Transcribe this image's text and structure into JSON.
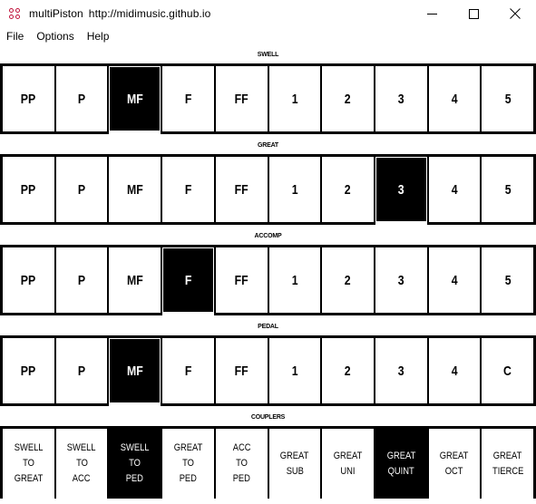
{
  "window": {
    "app_name": "multiPiston",
    "url": "http://midimusic.github.io"
  },
  "menu": [
    "File",
    "Options",
    "Help"
  ],
  "divisions": [
    {
      "label": "SWELL",
      "pistons": [
        "PP",
        "P",
        "MF",
        "F",
        "FF",
        "1",
        "2",
        "3",
        "4",
        "5"
      ],
      "active": "MF"
    },
    {
      "label": "GREAT",
      "pistons": [
        "PP",
        "P",
        "MF",
        "F",
        "FF",
        "1",
        "2",
        "3",
        "4",
        "5"
      ],
      "active": "3"
    },
    {
      "label": "ACCOMP",
      "pistons": [
        "PP",
        "P",
        "MF",
        "F",
        "FF",
        "1",
        "2",
        "3",
        "4",
        "5"
      ],
      "active": "F"
    },
    {
      "label": "PEDAL",
      "pistons": [
        "PP",
        "P",
        "MF",
        "F",
        "FF",
        "1",
        "2",
        "3",
        "4",
        "C"
      ],
      "active": "MF"
    }
  ],
  "couplers": {
    "label": "COUPLERS",
    "items": [
      {
        "lines": [
          "SWELL",
          "TO",
          "GREAT"
        ],
        "active": false
      },
      {
        "lines": [
          "SWELL",
          "TO",
          "ACC"
        ],
        "active": false
      },
      {
        "lines": [
          "SWELL",
          "TO",
          "PED"
        ],
        "active": true
      },
      {
        "lines": [
          "GREAT",
          "TO",
          "PED"
        ],
        "active": false
      },
      {
        "lines": [
          "ACC",
          "TO",
          "PED"
        ],
        "active": false
      },
      {
        "lines": [
          "GREAT",
          "SUB"
        ],
        "active": false
      },
      {
        "lines": [
          "GREAT",
          "UNI"
        ],
        "active": false
      },
      {
        "lines": [
          "GREAT",
          "QUINT"
        ],
        "active": true
      },
      {
        "lines": [
          "GREAT",
          "OCT"
        ],
        "active": false
      },
      {
        "lines": [
          "GREAT",
          "TIERCE"
        ],
        "active": false
      }
    ]
  },
  "colors": {
    "active_bg": "#000000",
    "inactive_bg": "#ffffff",
    "app_icon": "#c0143c"
  },
  "icons": {
    "app": "four-dots-icon",
    "minimize": "minimize-icon",
    "maximize": "maximize-icon",
    "close": "close-icon"
  }
}
